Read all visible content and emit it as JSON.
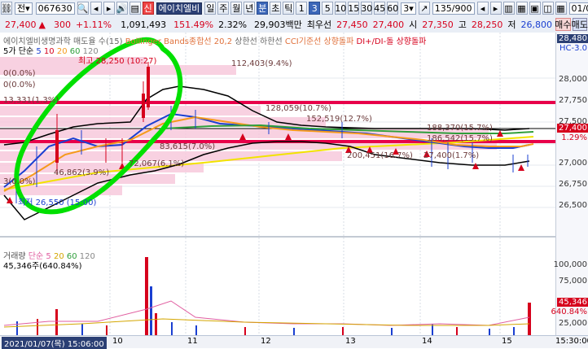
{
  "toolbar1": {
    "stock_code": "067630",
    "code_label": "전",
    "badge": "신",
    "stock_name": "에이치엘비",
    "periods": [
      "일",
      "주",
      "월",
      "년",
      "분",
      "초",
      "틱"
    ],
    "active_period": "분",
    "intervals": [
      "1",
      "3",
      "5",
      "10",
      "15",
      "30",
      "45",
      "60"
    ],
    "active_interval": "3",
    "count": "135/900",
    "date": "01/08",
    "interval_select": "3"
  },
  "toolbar2": {
    "price": "27,400",
    "change": "300",
    "change_pct": "+1.11%",
    "volume": "1,091,493",
    "vol_ratio": "151.49%",
    "turnover": "2.32%",
    "amount": "29,903백만",
    "best_ask_label": "최우선",
    "best_ask": "27,450",
    "best_bid": "27,400",
    "open_label": "시",
    "open": "27,350",
    "high_label": "고",
    "high": "28,250",
    "low_label": "저",
    "low": "26,800",
    "sell_label": "매수",
    "buy_label": "매도"
  },
  "legend": {
    "title": "에이치엘비생명과학 매도율 수(15)",
    "sma_label": "5가 단순",
    "sma_periods": [
      "5",
      "10",
      "20",
      "60",
      "120"
    ],
    "bollinger": "Bollinger Bands종합선 20,2",
    "upper": "상한선",
    "lower": "하한선",
    "cci": "CCI기준선 상향돌파",
    "dmi": "DI+/DI-돌 상향돌파",
    "right_tag": "HC-3.0"
  },
  "price_annotations": {
    "high_point": "최고 28,250 (10:27)",
    "low_point": "최저 26,550 (15:00)",
    "low_point_short": "26,550",
    "zero_a": "0(0.0%)",
    "zero_b": "0(0.0%)",
    "left_a": "13,331(1.3%)",
    "left_b": "3(0.0%)",
    "vp1": "112,403(9.4%)",
    "vp2": "128,059(10.7%)",
    "vp3": "152,519(12.7%)",
    "vp4": "188,370(15.7%)",
    "vp5": "186,542(15.7%)",
    "vp6": "83,615(7.0%)",
    "vp7": "72,067(6.1%)",
    "vp8": "46,862(3.9%)",
    "vp9": "200,451(16.7%)",
    "vp10": "27,400(1.7%)"
  },
  "price_axis": {
    "ticks": [
      "28,250",
      "28,000",
      "27,750",
      "27,500",
      "27,250",
      "27,000",
      "26,750",
      "26,500",
      "26,250"
    ],
    "current_tag": "27,400",
    "current_pct": "1.29%",
    "top_tag": "28,480"
  },
  "volume_panel": {
    "title": "거래량",
    "sma_label": "단순",
    "periods": [
      "5",
      "20",
      "60",
      "120"
    ],
    "current": "45,346주(640.84%)",
    "axis_ticks": [
      "100,000",
      "75,000",
      "50,000",
      "25,000"
    ],
    "current_tag": "45,346",
    "current_pct": "640.84%"
  },
  "time_axis": {
    "cursor_label": "2021/01/07(목) 15:06:00",
    "labels": [
      "10",
      "11",
      "12",
      "13",
      "14",
      "15"
    ],
    "right_label": "15:30:00",
    "left_label": "4"
  },
  "colors": {
    "up": "#d6001c",
    "down": "#1a3fd1",
    "bollinger": "#000000",
    "support_line": "#e8004a",
    "highlight": "#00e000"
  }
}
